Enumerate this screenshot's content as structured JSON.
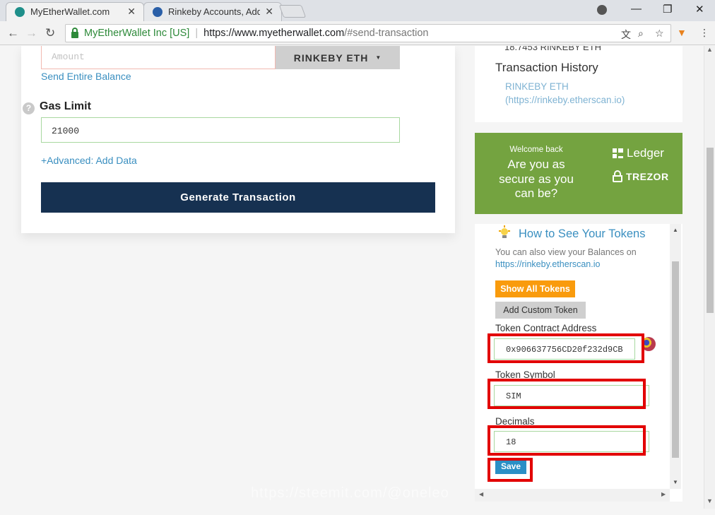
{
  "browser": {
    "tabs": [
      {
        "title": "MyEtherWallet.com",
        "active": true
      },
      {
        "title": "Rinkeby Accounts, Address",
        "active": false
      }
    ],
    "url": {
      "org": "MyEtherWallet Inc [US]",
      "host": "https://www.myetherwallet.com",
      "path": "/#send-transaction"
    }
  },
  "send_form": {
    "amount_placeholder": "Amount",
    "unit": "RINKEBY ETH",
    "send_entire_balance": "Send Entire Balance",
    "help_glyph": "?",
    "gas_limit_label": "Gas Limit",
    "gas_limit_value": "21000",
    "advanced_link": "+Advanced: Add Data",
    "generate_button": "Generate Transaction"
  },
  "sidebar": {
    "balance_cutoff": "18.7453 RINKEBY ETH",
    "tx_history_title": "Transaction History",
    "tx_history_link": "RINKEBY ETH (https://rinkeby.etherscan.io)",
    "hw_ad": {
      "welcome": "Welcome back",
      "question": "Are you as secure as you can be?",
      "ledger": "Ledger",
      "trezor": "TREZOR"
    },
    "tokens": {
      "title": "How to See Your Tokens",
      "desc": "You can also view your Balances on",
      "desc_link": "https://rinkeby.etherscan.io",
      "show_all": "Show All Tokens",
      "add_custom": "Add Custom Token",
      "contract_label": "Token Contract Address",
      "contract_value": "0x906637756CD20f232d9CB",
      "symbol_label": "Token Symbol",
      "symbol_value": "SIM",
      "decimals_label": "Decimals",
      "decimals_value": "18",
      "save": "Save"
    }
  },
  "watermark": "https://steemit.com/@oneleo",
  "colors": {
    "navy_button": "#163151",
    "link_blue": "#3a8fc0",
    "ad_green": "#74a340",
    "orange_button": "#f99b0d",
    "highlight_red": "#e20000"
  }
}
